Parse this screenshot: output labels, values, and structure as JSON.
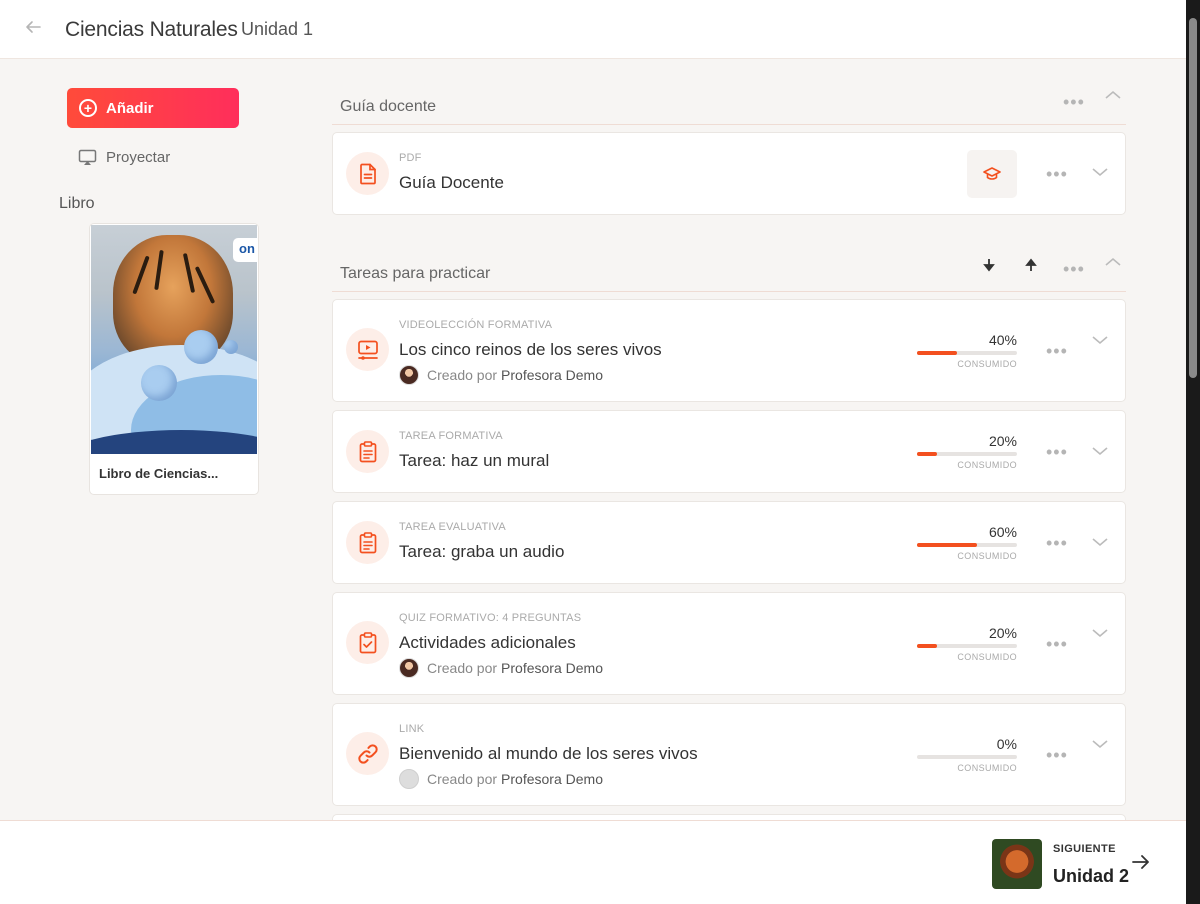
{
  "header": {
    "course": "Ciencias Naturales",
    "unit": "Unidad 1",
    "back_icon": "arrow-left-icon"
  },
  "sidebar": {
    "add_label": "Añadir",
    "project_label": "Proyectar",
    "book_section_label": "Libro",
    "book_title": "Libro de Ciencias...",
    "book_badge": "on"
  },
  "sections": [
    {
      "title": "Guía docente",
      "items": [
        {
          "type": "PDF",
          "title": "Guía Docente",
          "icon": "document-icon"
        }
      ]
    },
    {
      "title": "Tareas para practicar",
      "items": [
        {
          "type": "VIDEOLECCIÓN FORMATIVA",
          "title": "Los cinco reinos de los seres vivos",
          "author_prefix": "Creado por",
          "author": "Profesora Demo",
          "progress": "40%",
          "progress_value": 0.4,
          "progress_caption": "CONSUMIDO",
          "icon": "video-lesson-icon"
        },
        {
          "type": "TAREA FORMATIVA",
          "title": "Tarea: haz un mural",
          "progress": "20%",
          "progress_value": 0.2,
          "progress_caption": "CONSUMIDO",
          "icon": "clipboard-icon"
        },
        {
          "type": "TAREA EVALUATIVA",
          "title": "Tarea: graba un audio",
          "progress": "60%",
          "progress_value": 0.6,
          "progress_caption": "CONSUMIDO",
          "icon": "clipboard-icon"
        },
        {
          "type": "QUIZ FORMATIVO: 4 PREGUNTAS",
          "title": "Actividades adicionales",
          "author_prefix": "Creado por",
          "author": "Profesora Demo",
          "progress": "20%",
          "progress_value": 0.2,
          "progress_caption": "CONSUMIDO",
          "icon": "checklist-icon"
        },
        {
          "type": "LINK",
          "title": "Bienvenido al mundo de los seres vivos",
          "author_prefix": "Creado por",
          "author": "Profesora Demo",
          "progress": "0%",
          "progress_value": 0.0,
          "progress_caption": "CONSUMIDO",
          "icon": "link-icon"
        }
      ]
    }
  ],
  "footer": {
    "next_label": "SIGUIENTE",
    "next_unit": "Unidad 2"
  },
  "colors": {
    "accent": "#f3501f",
    "add_gradient_start": "#ff4b3a",
    "add_gradient_end": "#ff2e5b",
    "icon_bg": "#fdeee8"
  }
}
